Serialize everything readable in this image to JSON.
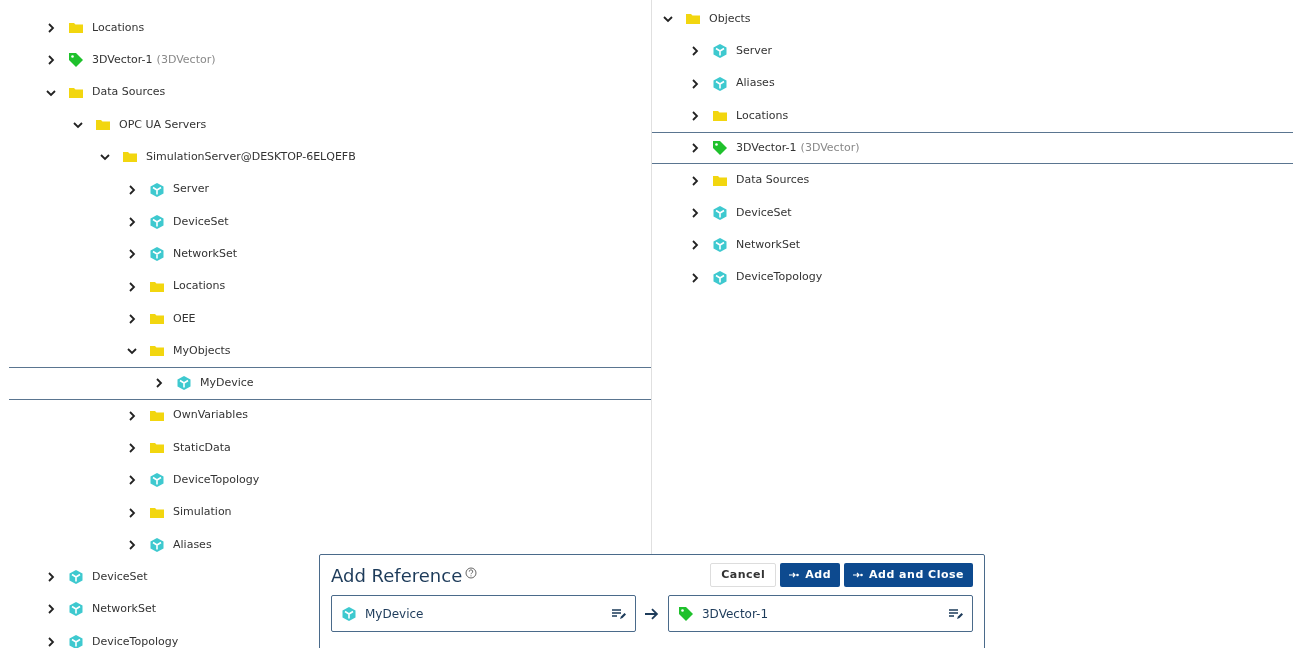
{
  "left_tree": [
    {
      "kind": "folder",
      "label": "Locations",
      "expanded": false,
      "selected": false
    },
    {
      "kind": "tag",
      "label": "3DVector-1",
      "type": "(3DVector)",
      "expanded": false,
      "selected": false
    },
    {
      "kind": "folder",
      "label": "Data Sources",
      "expanded": true,
      "selected": false,
      "children": [
        {
          "kind": "folder",
          "label": "OPC UA Servers",
          "expanded": true,
          "selected": false,
          "children": [
            {
              "kind": "folder",
              "label": "SimulationServer@DESKTOP-6ELQEFB",
              "expanded": true,
              "selected": false,
              "children": [
                {
                  "kind": "object",
                  "label": "Server",
                  "expanded": false,
                  "selected": false
                },
                {
                  "kind": "object",
                  "label": "DeviceSet",
                  "expanded": false,
                  "selected": false
                },
                {
                  "kind": "object",
                  "label": "NetworkSet",
                  "expanded": false,
                  "selected": false
                },
                {
                  "kind": "folder",
                  "label": "Locations",
                  "expanded": false,
                  "selected": false
                },
                {
                  "kind": "folder",
                  "label": "OEE",
                  "expanded": false,
                  "selected": false
                },
                {
                  "kind": "folder",
                  "label": "MyObjects",
                  "expanded": true,
                  "selected": false,
                  "children": [
                    {
                      "kind": "object",
                      "label": "MyDevice",
                      "expanded": false,
                      "selected": true
                    }
                  ]
                },
                {
                  "kind": "folder",
                  "label": "OwnVariables",
                  "expanded": false,
                  "selected": false
                },
                {
                  "kind": "folder",
                  "label": "StaticData",
                  "expanded": false,
                  "selected": false
                },
                {
                  "kind": "object",
                  "label": "DeviceTopology",
                  "expanded": false,
                  "selected": false
                },
                {
                  "kind": "folder",
                  "label": "Simulation",
                  "expanded": false,
                  "selected": false
                },
                {
                  "kind": "object",
                  "label": "Aliases",
                  "expanded": false,
                  "selected": false
                }
              ]
            }
          ]
        }
      ]
    },
    {
      "kind": "object",
      "label": "DeviceSet",
      "expanded": false,
      "selected": false
    },
    {
      "kind": "object",
      "label": "NetworkSet",
      "expanded": false,
      "selected": false
    },
    {
      "kind": "object",
      "label": "DeviceTopology",
      "expanded": false,
      "selected": false
    }
  ],
  "right_tree": [
    {
      "kind": "folder",
      "label": "Objects",
      "expanded": true,
      "selected": false,
      "children": [
        {
          "kind": "object",
          "label": "Server",
          "expanded": false,
          "selected": false
        },
        {
          "kind": "object",
          "label": "Aliases",
          "expanded": false,
          "selected": false
        },
        {
          "kind": "folder",
          "label": "Locations",
          "expanded": false,
          "selected": false
        },
        {
          "kind": "tag",
          "label": "3DVector-1",
          "type": "(3DVector)",
          "expanded": false,
          "selected": true
        },
        {
          "kind": "folder",
          "label": "Data Sources",
          "expanded": false,
          "selected": false
        },
        {
          "kind": "object",
          "label": "DeviceSet",
          "expanded": false,
          "selected": false
        },
        {
          "kind": "object",
          "label": "NetworkSet",
          "expanded": false,
          "selected": false
        },
        {
          "kind": "object",
          "label": "DeviceTopology",
          "expanded": false,
          "selected": false
        }
      ]
    }
  ],
  "dialog": {
    "title": "Add Reference",
    "buttons": [
      {
        "label": "Cancel",
        "kind": "secondary"
      },
      {
        "label": "Add",
        "kind": "primary"
      },
      {
        "label": "Add and Close",
        "kind": "primary"
      }
    ],
    "source": {
      "kind": "object",
      "label": "MyDevice"
    },
    "target": {
      "kind": "tag",
      "label": "3DVector-1"
    }
  }
}
